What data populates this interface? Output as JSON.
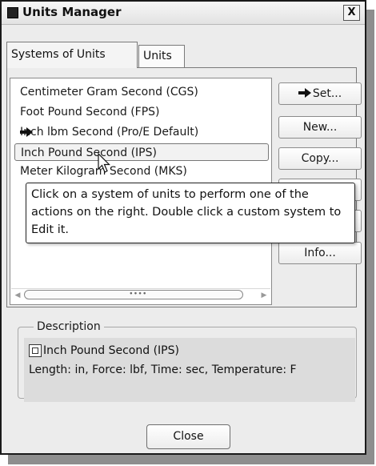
{
  "window": {
    "title": "Units Manager",
    "close_glyph": "X"
  },
  "tabs": [
    {
      "label": "Systems of Units",
      "active": true
    },
    {
      "label": "Units",
      "active": false
    }
  ],
  "unit_systems": [
    {
      "label": "Centimeter Gram Second (CGS)",
      "marker": null,
      "selected": false
    },
    {
      "label": "Foot Pound Second (FPS)",
      "marker": null,
      "selected": false
    },
    {
      "label": "Inch lbm Second (Pro/E Default)",
      "marker": "arrow-right-icon",
      "selected": false
    },
    {
      "label": "Inch Pound Second (IPS)",
      "marker": null,
      "selected": true
    },
    {
      "label": "Meter Kilogram Second (MKS)",
      "marker": null,
      "selected": false
    }
  ],
  "buttons": {
    "set_label": "Set...",
    "new_label": "New...",
    "copy_label": "Copy...",
    "info_label": "Info..."
  },
  "scrollbar": {
    "grip": "∙∙∙∙"
  },
  "tooltip": {
    "text": "Click on a system of units to perform one of the actions on the right. Double click a custom system to Edit it."
  },
  "description": {
    "legend": "Description",
    "system_name": "Inch Pound Second (IPS)",
    "details": "Length: in, Force: lbf, Time: sec, Temperature: F"
  },
  "footer": {
    "close_label": "Close"
  },
  "colors": {
    "window_bg": "#ececec",
    "selection_border": "#777777",
    "tooltip_bg": "#ffffff",
    "description_bg": "#dcdcdc"
  }
}
